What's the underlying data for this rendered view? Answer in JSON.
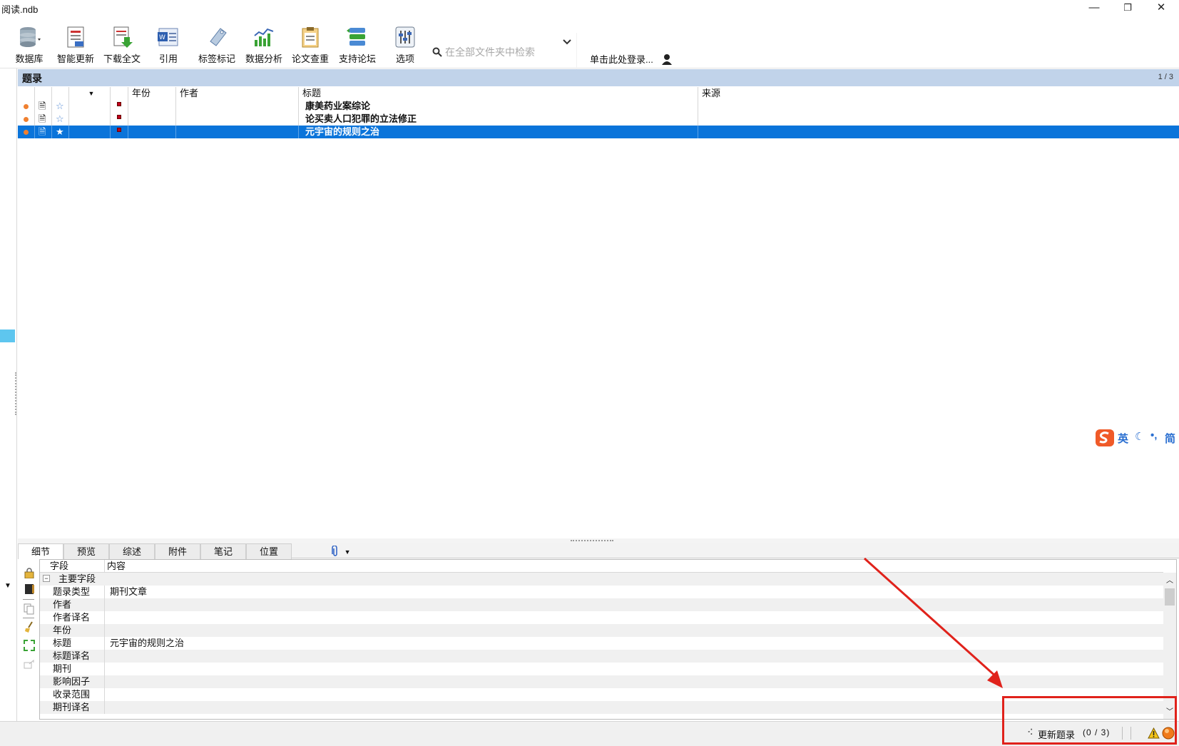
{
  "window": {
    "title": "阅读.ndb"
  },
  "toolbar": {
    "buttons": [
      {
        "label": "数据库"
      },
      {
        "label": "智能更新"
      },
      {
        "label": "下载全文"
      },
      {
        "label": "引用"
      },
      {
        "label": "标签标记"
      },
      {
        "label": "数据分析"
      },
      {
        "label": "论文查重"
      },
      {
        "label": "支持论坛"
      },
      {
        "label": "选项"
      }
    ],
    "search_placeholder": "在全部文件夹中检索",
    "login_label": "单击此处登录..."
  },
  "records": {
    "title": "题录",
    "page": "1 / 3",
    "columns": {
      "year": "年份",
      "author": "作者",
      "title": "标题",
      "source": "来源"
    },
    "rows": [
      {
        "year": "",
        "author": "",
        "title": "康美药业案综论",
        "source": ""
      },
      {
        "year": "",
        "author": "",
        "title": "论买卖人口犯罪的立法修正",
        "source": ""
      },
      {
        "year": "",
        "author": "",
        "title": "元宇宙的规则之治",
        "source": ""
      }
    ]
  },
  "tabs": [
    "细节",
    "预览",
    "综述",
    "附件",
    "笔记",
    "位置"
  ],
  "detail": {
    "field_header": "字段",
    "content_header": "内容",
    "group": "主要字段",
    "rows": [
      {
        "field": "题录类型",
        "content": "期刊文章"
      },
      {
        "field": "作者",
        "content": ""
      },
      {
        "field": "作者译名",
        "content": ""
      },
      {
        "field": "年份",
        "content": ""
      },
      {
        "field": "标题",
        "content": "元宇宙的规则之治"
      },
      {
        "field": "标题译名",
        "content": ""
      },
      {
        "field": "期刊",
        "content": ""
      },
      {
        "field": "影响因子",
        "content": ""
      },
      {
        "field": "收录范围",
        "content": ""
      },
      {
        "field": "期刊译名",
        "content": ""
      }
    ]
  },
  "status": {
    "update_label": "更新题录",
    "update_count": "(0 / 3)"
  },
  "ime": {
    "mode": "英",
    "width": "简"
  },
  "colors": {
    "selection": "#0a74da",
    "header": "#c1d3ea",
    "annotation": "#e0221b"
  }
}
